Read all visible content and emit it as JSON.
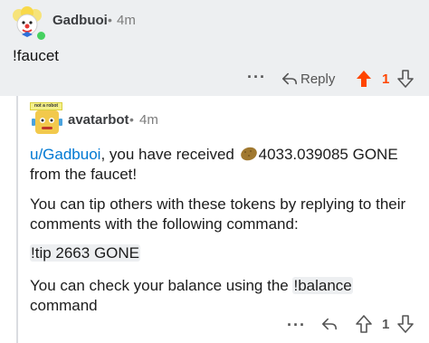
{
  "parent_comment": {
    "author": "Gadbuoi",
    "separator": "•",
    "time": "4m",
    "body": "!faucet",
    "actions": {
      "more_label": "···",
      "reply_label": "Reply",
      "score": "1",
      "vote_state": "upvoted",
      "upvote_color": "#ff4500"
    }
  },
  "reply_comment": {
    "badge": "not a robot",
    "author": "avatarbot",
    "separator": "•",
    "time": "4m",
    "p1_user": "u/Gadbuoi",
    "p1_a": ", you have received ",
    "p1_b": "4033.039085 GONE from the faucet!",
    "p2": "You can tip others with these tokens by replying to their comments with the following command:",
    "command": "!tip 2663 GONE",
    "p3_a": "You can check your balance using the ",
    "p3_cmd": "!balance",
    "p3_b": " command",
    "actions": {
      "more_label": "···",
      "score": "1"
    }
  },
  "colors": {
    "link": "#0079d3",
    "upvote_active": "#ff4500",
    "parent_background": "#edeff1"
  }
}
